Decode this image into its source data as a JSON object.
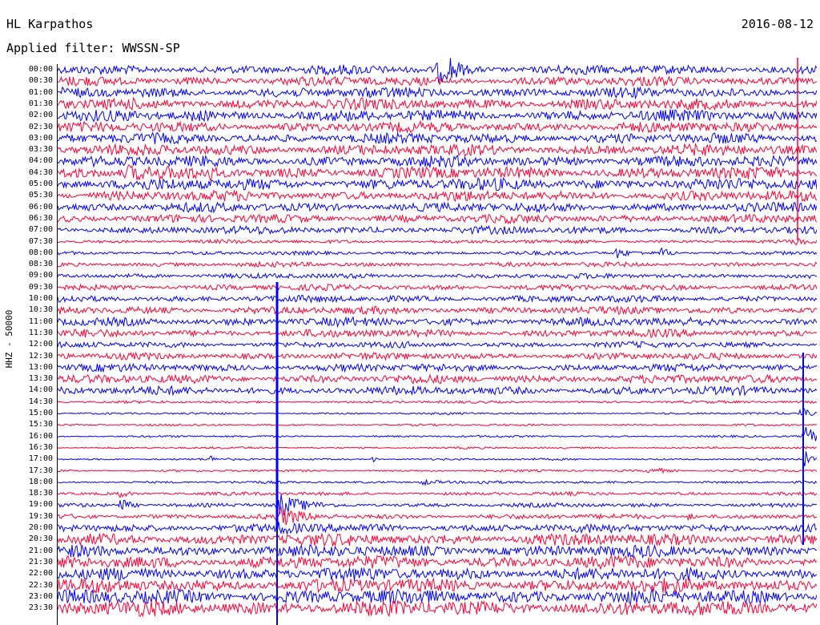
{
  "header": {
    "station": "HL Karpathos",
    "date": "2016-08-12",
    "filter": "Applied filter: WWSSN-SP"
  },
  "axis": {
    "label": "HHZ - 50000"
  },
  "colors": {
    "trace_a": "#0000ff",
    "trace_b": "#ff0033",
    "background": "#ffffff",
    "text": "#000000"
  },
  "traces": {
    "rows": [
      {
        "time": "00:00",
        "color": "blue",
        "noise": 0.55
      },
      {
        "time": "00:30",
        "color": "red",
        "noise": 0.55
      },
      {
        "time": "01:00",
        "color": "blue",
        "noise": 0.6
      },
      {
        "time": "01:30",
        "color": "red",
        "noise": 0.65
      },
      {
        "time": "02:00",
        "color": "blue",
        "noise": 0.65
      },
      {
        "time": "02:30",
        "color": "red",
        "noise": 0.6
      },
      {
        "time": "03:00",
        "color": "blue",
        "noise": 0.6
      },
      {
        "time": "03:30",
        "color": "red",
        "noise": 0.65
      },
      {
        "time": "04:00",
        "color": "blue",
        "noise": 0.65
      },
      {
        "time": "04:30",
        "color": "red",
        "noise": 0.7
      },
      {
        "time": "05:00",
        "color": "blue",
        "noise": 0.7
      },
      {
        "time": "05:30",
        "color": "red",
        "noise": 0.6
      },
      {
        "time": "06:00",
        "color": "blue",
        "noise": 0.55
      },
      {
        "time": "06:30",
        "color": "red",
        "noise": 0.5
      },
      {
        "time": "07:00",
        "color": "blue",
        "noise": 0.45
      },
      {
        "time": "07:30",
        "color": "red",
        "noise": 0.22
      },
      {
        "time": "08:00",
        "color": "blue",
        "noise": 0.22
      },
      {
        "time": "08:30",
        "color": "red",
        "noise": 0.28
      },
      {
        "time": "09:00",
        "color": "blue",
        "noise": 0.3
      },
      {
        "time": "09:30",
        "color": "red",
        "noise": 0.35
      },
      {
        "time": "10:00",
        "color": "blue",
        "noise": 0.4
      },
      {
        "time": "10:30",
        "color": "red",
        "noise": 0.45
      },
      {
        "time": "11:00",
        "color": "blue",
        "noise": 0.5
      },
      {
        "time": "11:30",
        "color": "red",
        "noise": 0.45
      },
      {
        "time": "12:00",
        "color": "blue",
        "noise": 0.35
      },
      {
        "time": "12:30",
        "color": "red",
        "noise": 0.4
      },
      {
        "time": "13:00",
        "color": "blue",
        "noise": 0.45
      },
      {
        "time": "13:30",
        "color": "red",
        "noise": 0.5
      },
      {
        "time": "14:00",
        "color": "blue",
        "noise": 0.5
      },
      {
        "time": "14:30",
        "color": "red",
        "noise": 0.15
      },
      {
        "time": "15:00",
        "color": "blue",
        "noise": 0.12
      },
      {
        "time": "15:30",
        "color": "red",
        "noise": 0.12
      },
      {
        "time": "16:00",
        "color": "blue",
        "noise": 0.12
      },
      {
        "time": "16:30",
        "color": "red",
        "noise": 0.12
      },
      {
        "time": "17:00",
        "color": "blue",
        "noise": 0.12
      },
      {
        "time": "17:30",
        "color": "red",
        "noise": 0.13
      },
      {
        "time": "18:00",
        "color": "blue",
        "noise": 0.15
      },
      {
        "time": "18:30",
        "color": "red",
        "noise": 0.2
      },
      {
        "time": "19:00",
        "color": "blue",
        "noise": 0.25
      },
      {
        "time": "19:30",
        "color": "red",
        "noise": 0.3
      },
      {
        "time": "20:00",
        "color": "blue",
        "noise": 0.5
      },
      {
        "time": "20:30",
        "color": "red",
        "noise": 0.7
      },
      {
        "time": "21:00",
        "color": "blue",
        "noise": 0.7
      },
      {
        "time": "21:30",
        "color": "red",
        "noise": 0.75
      },
      {
        "time": "22:00",
        "color": "blue",
        "noise": 0.75
      },
      {
        "time": "22:30",
        "color": "red",
        "noise": 0.8
      },
      {
        "time": "23:00",
        "color": "blue",
        "noise": 0.85
      },
      {
        "time": "23:30",
        "color": "red",
        "noise": 0.9
      }
    ]
  }
}
